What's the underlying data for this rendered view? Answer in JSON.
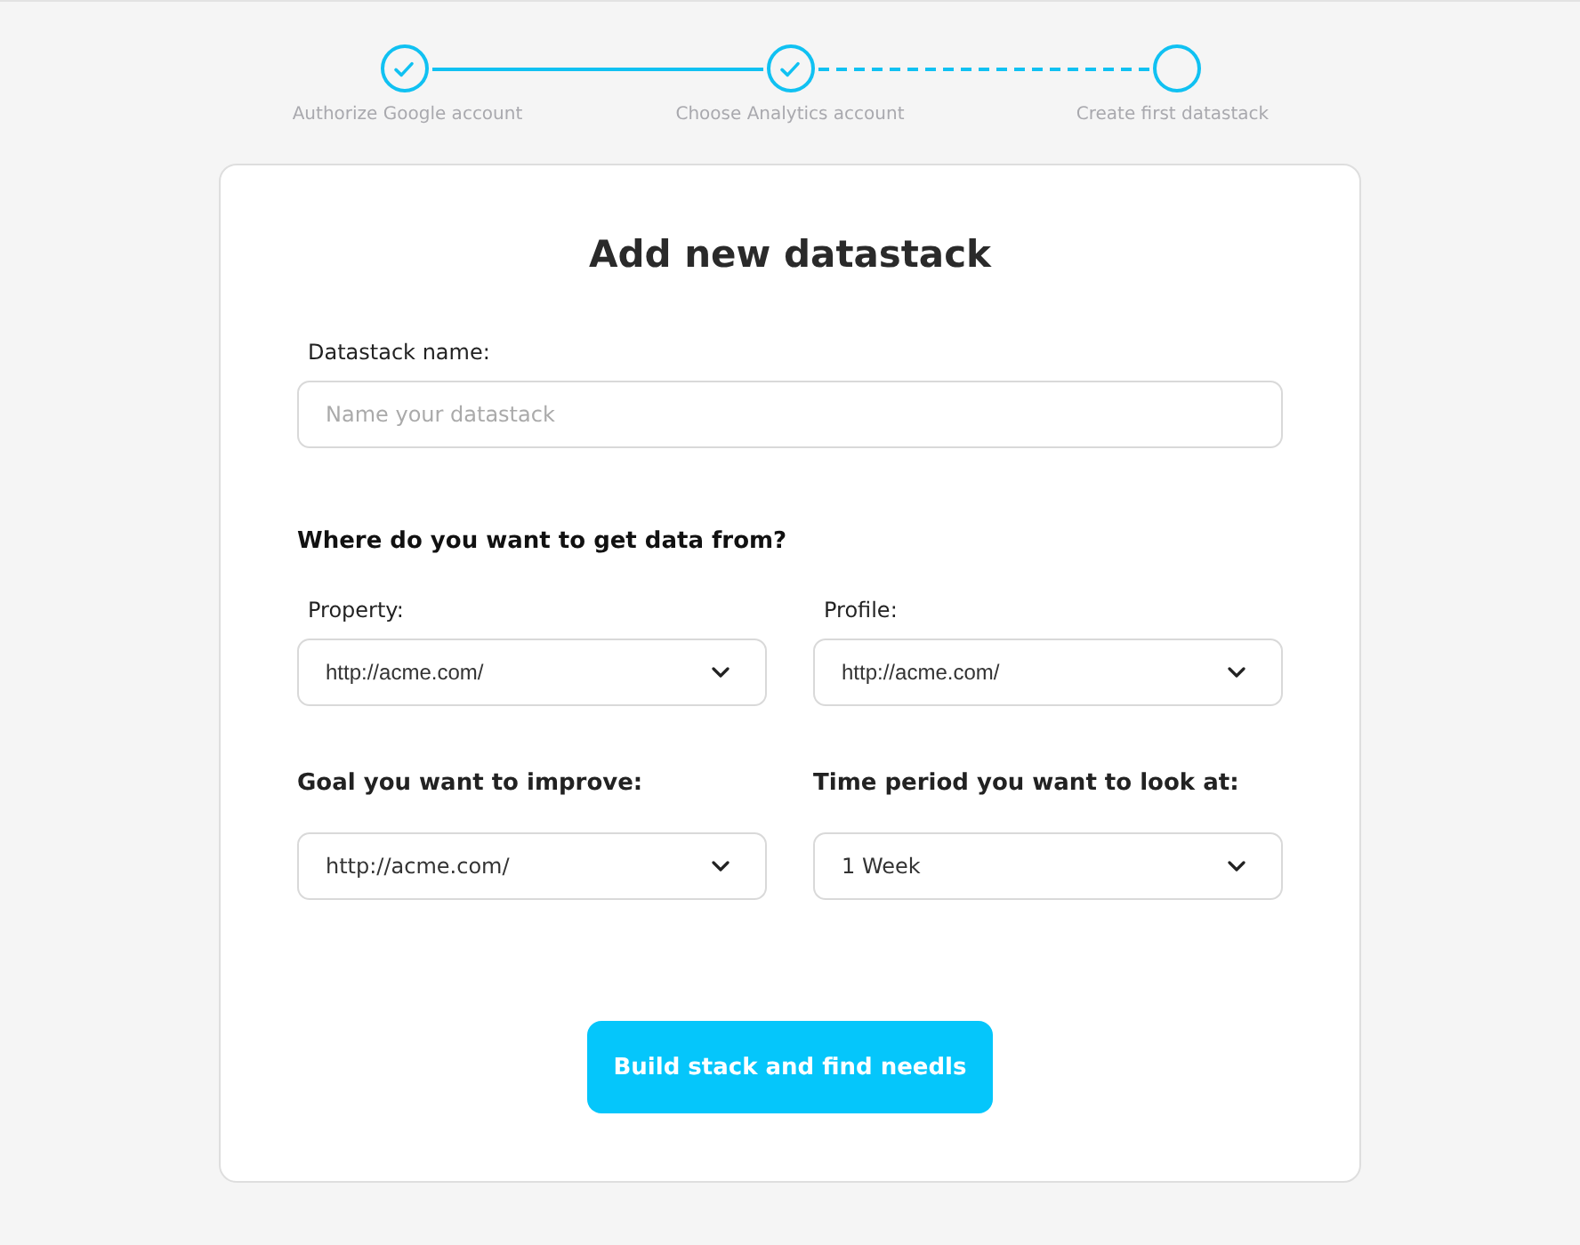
{
  "steps": [
    {
      "label": "Authorize Google account",
      "completed": true
    },
    {
      "label": "Choose Analytics account",
      "completed": true
    },
    {
      "label": "Create first datastack",
      "completed": false
    }
  ],
  "form": {
    "title": "Add new datastack",
    "name_field": {
      "label": "Datastack name:",
      "placeholder": "Name your datastack"
    },
    "source_section": {
      "heading": "Where do you want to get data from?",
      "fields": [
        {
          "label": "Property:",
          "value": "http://acme.com/"
        },
        {
          "label": "Profile:",
          "value": "http://acme.com/"
        }
      ]
    },
    "goal_fields": [
      {
        "label": "Goal you want to improve:",
        "value": "http://acme.com/"
      },
      {
        "label": "Time period you want to look at:",
        "value": "1 Week"
      }
    ],
    "submit_button": "Build stack and find needls"
  }
}
